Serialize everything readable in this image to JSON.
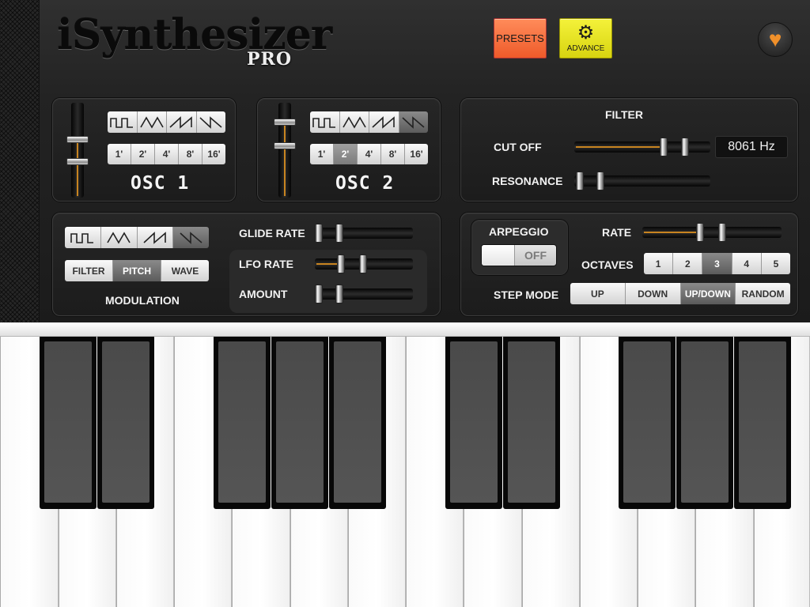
{
  "header": {
    "logo": "iSynthesizer",
    "logo_suffix": "PRO",
    "presets_label": "PRESETS",
    "advance_label": "ADVANCE",
    "advance_icon": "gear-icon",
    "favorite_icon": "heart-icon",
    "presets_color": "#ee6a3a",
    "advance_color": "#e8e620",
    "favorite_color": "#f0902a"
  },
  "osc1": {
    "label": "OSC 1",
    "waveforms": [
      "square",
      "triangle",
      "sawtooth",
      "ramp"
    ],
    "selected_waveform": "ramp",
    "octaves": [
      "1'",
      "2'",
      "4'",
      "8'",
      "16'"
    ],
    "selected_octave": "none"
  },
  "osc2": {
    "label": "OSC 2",
    "waveforms": [
      "square",
      "triangle",
      "sawtooth",
      "ramp"
    ],
    "selected_waveform": "ramp",
    "octaves": [
      "1'",
      "2'",
      "4'",
      "8'",
      "16'"
    ],
    "selected_octave": "2'"
  },
  "filter": {
    "title": "FILTER",
    "cutoff_label": "CUT OFF",
    "cutoff_value": "8061 Hz",
    "resonance_label": "RESONANCE"
  },
  "modulation": {
    "label": "MODULATION",
    "waveforms": [
      "square",
      "triangle",
      "sawtooth",
      "ramp"
    ],
    "selected_waveform": "ramp",
    "targets": [
      "FILTER",
      "PITCH",
      "WAVE"
    ],
    "selected_target": "PITCH",
    "glide_rate_label": "GLIDE RATE",
    "lfo_rate_label": "LFO RATE",
    "amount_label": "AMOUNT"
  },
  "arpeggio": {
    "label": "ARPEGGIO",
    "toggle_state": "OFF",
    "rate_label": "RATE",
    "octaves_label": "OCTAVES",
    "octaves": [
      "1",
      "2",
      "3",
      "4",
      "5"
    ],
    "selected_octave": "3",
    "step_mode_label": "STEP MODE",
    "step_modes": [
      "UP",
      "DOWN",
      "UP/DOWN",
      "RANDOM"
    ],
    "selected_step_mode": "UP/DOWN"
  },
  "keyboard": {
    "white_keys": 14,
    "black_keys": 10
  }
}
